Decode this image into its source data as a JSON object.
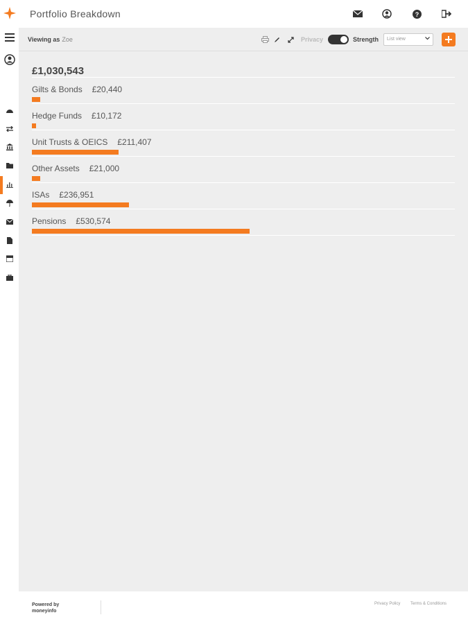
{
  "header": {
    "title": "Portfolio Breakdown",
    "icons": [
      "envelope-icon",
      "user-circle-icon",
      "help-icon",
      "logout-icon"
    ]
  },
  "toolbar": {
    "viewing_as_label": "Viewing as",
    "viewing_as_user": "Zoe",
    "privacy_label": "Privacy",
    "privacy_on": true,
    "strength_label": "Strength",
    "view_select_value": "List view",
    "add_label": "+"
  },
  "portfolio": {
    "total": "£1,030,543",
    "rows": [
      {
        "label": "Gilts & Bonds",
        "amount": "£20,440",
        "value": 20440
      },
      {
        "label": "Hedge Funds",
        "amount": "£10,172",
        "value": 10172
      },
      {
        "label": "Unit Trusts & OEICS",
        "amount": "£211,407",
        "value": 211407
      },
      {
        "label": "Other Assets",
        "amount": "£21,000",
        "value": 21000
      },
      {
        "label": "ISAs",
        "amount": "£236,951",
        "value": 236951
      },
      {
        "label": "Pensions",
        "amount": "£530,574",
        "value": 530574
      }
    ]
  },
  "sidebar": {
    "items": [
      "dashboard-icon",
      "transfer-icon",
      "bank-icon",
      "folder-icon",
      "chart-icon",
      "umbrella-icon",
      "mail-icon",
      "document-icon",
      "calendar-icon",
      "briefcase-icon"
    ],
    "active": "chart-icon"
  },
  "footer": {
    "powered_by": "Powered by",
    "brand": "moneyinfo",
    "privacy_policy": "Privacy Policy",
    "terms": "Terms & Conditions"
  },
  "colors": {
    "accent": "#f47b20",
    "background": "#eeeeee"
  }
}
